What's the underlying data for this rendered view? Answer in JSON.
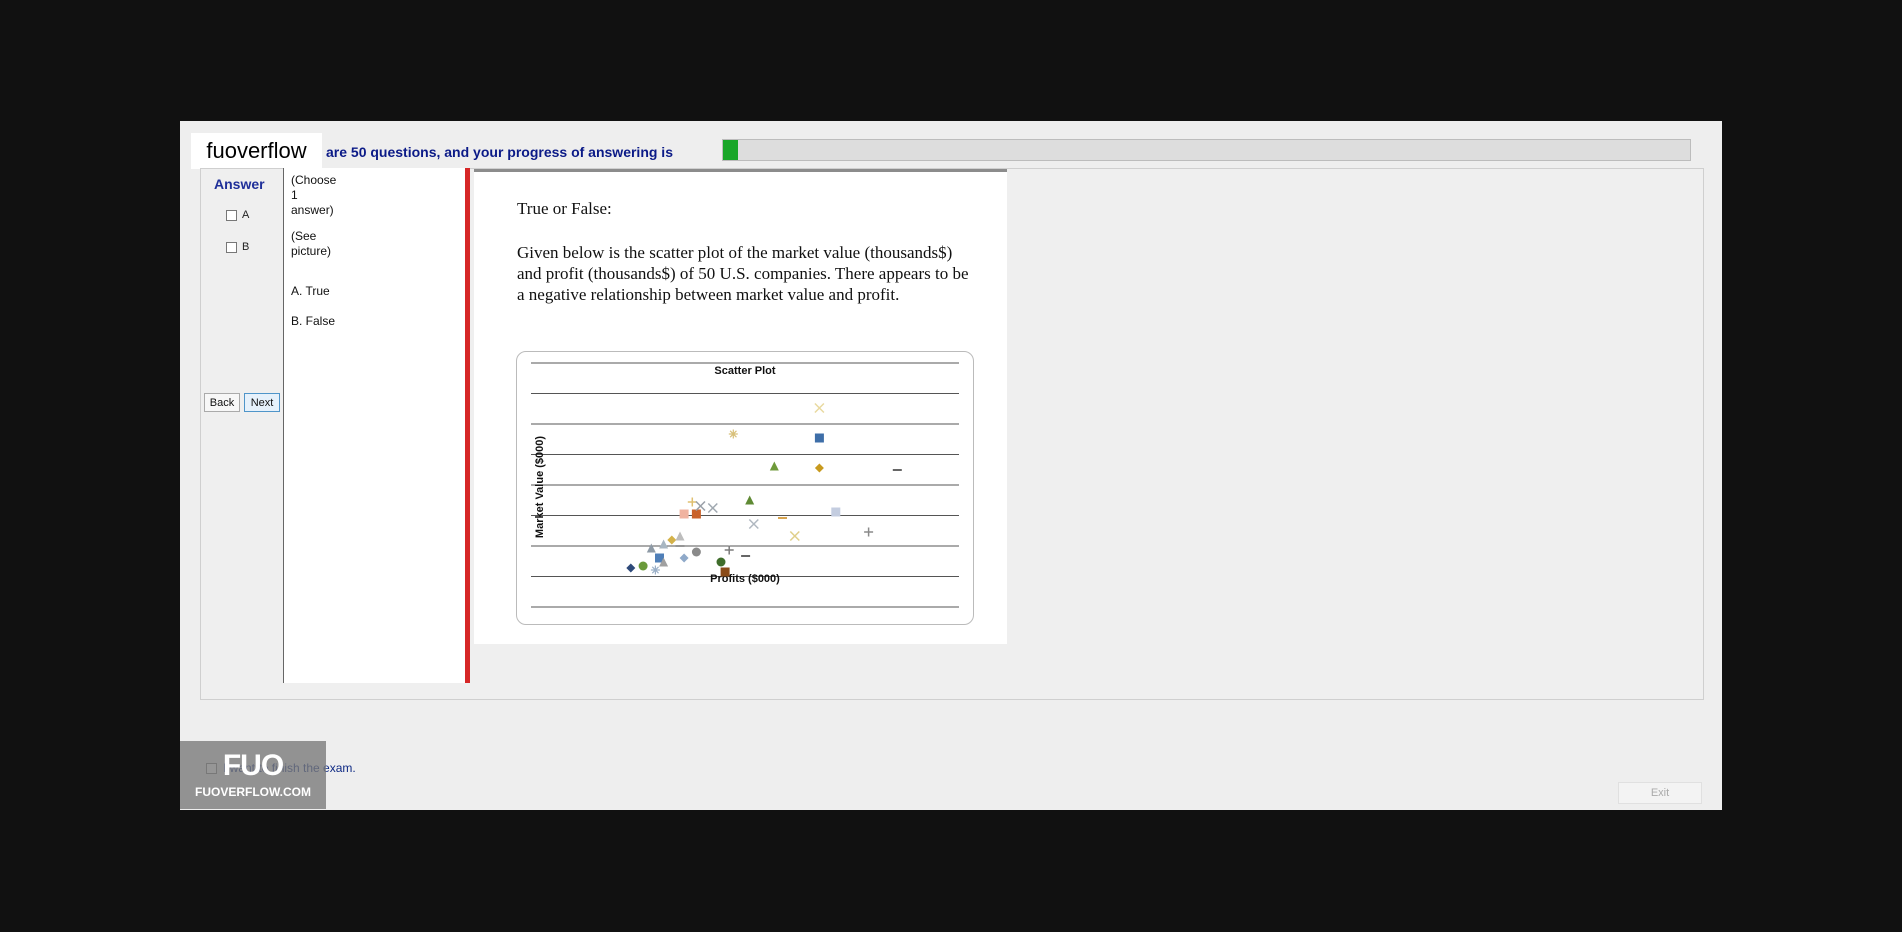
{
  "brand": {
    "name": "fuoverflow"
  },
  "header": {
    "progress_text": "are 50 questions, and your progress of answering is",
    "progress_fraction": 0.016
  },
  "answer_panel": {
    "title": "Answer",
    "options": [
      "A",
      "B"
    ],
    "back_label": "Back",
    "next_label": "Next"
  },
  "choice_list": {
    "choose_line1": "(Choose",
    "choose_line2": "1",
    "choose_line3": "answer)",
    "see_line1": "(See",
    "see_line2": "picture)",
    "a": "A.  True",
    "b": "B.  False"
  },
  "question": {
    "title": "True or False:",
    "body": "Given below is the scatter  plot of the market value (thousands$) and profit (thousands$) of 50 U.S. companies. There appears to be a negative relationship between market value and profit."
  },
  "chart_data": {
    "type": "scatter",
    "title": "Scatter Plot",
    "xlabel": "Profits ($000)",
    "ylabel": "Market Value ($000)",
    "grid": true,
    "legend": "none",
    "points": [
      {
        "x": 0.18,
        "y": 0.12,
        "marker": "diamond",
        "color": "#2e4a7a"
      },
      {
        "x": 0.21,
        "y": 0.13,
        "marker": "circle",
        "color": "#6a9a3a"
      },
      {
        "x": 0.24,
        "y": 0.11,
        "marker": "star",
        "color": "#9bb0c8"
      },
      {
        "x": 0.25,
        "y": 0.17,
        "marker": "square",
        "color": "#4f7fb8"
      },
      {
        "x": 0.26,
        "y": 0.15,
        "marker": "triangle",
        "color": "#a0a0a0"
      },
      {
        "x": 0.23,
        "y": 0.22,
        "marker": "triangle",
        "color": "#8e9aa6"
      },
      {
        "x": 0.26,
        "y": 0.24,
        "marker": "triangle",
        "color": "#a8b6c2"
      },
      {
        "x": 0.28,
        "y": 0.26,
        "marker": "diamond",
        "color": "#d4b24a"
      },
      {
        "x": 0.3,
        "y": 0.28,
        "marker": "triangle",
        "color": "#bdbdbd"
      },
      {
        "x": 0.3,
        "y": 0.23,
        "marker": "dash",
        "color": "#8a8a8a"
      },
      {
        "x": 0.31,
        "y": 0.17,
        "marker": "diamond",
        "color": "#8fa9c9"
      },
      {
        "x": 0.34,
        "y": 0.2,
        "marker": "circle",
        "color": "#8a8a8a"
      },
      {
        "x": 0.4,
        "y": 0.15,
        "marker": "circle",
        "color": "#3f6d2b"
      },
      {
        "x": 0.41,
        "y": 0.1,
        "marker": "square",
        "color": "#8a4b18"
      },
      {
        "x": 0.31,
        "y": 0.39,
        "marker": "square",
        "color": "#f0b3a0"
      },
      {
        "x": 0.34,
        "y": 0.39,
        "marker": "square",
        "color": "#c9622b"
      },
      {
        "x": 0.33,
        "y": 0.45,
        "marker": "plus",
        "color": "#e0c070"
      },
      {
        "x": 0.35,
        "y": 0.43,
        "marker": "x",
        "color": "#9aa0a8"
      },
      {
        "x": 0.38,
        "y": 0.42,
        "marker": "x",
        "color": "#a0a8b0"
      },
      {
        "x": 0.47,
        "y": 0.46,
        "marker": "triangle",
        "color": "#5f8a34"
      },
      {
        "x": 0.43,
        "y": 0.79,
        "marker": "star",
        "color": "#d8c07a"
      },
      {
        "x": 0.42,
        "y": 0.21,
        "marker": "plus",
        "color": "#7b7b7b"
      },
      {
        "x": 0.46,
        "y": 0.18,
        "marker": "dash",
        "color": "#555555"
      },
      {
        "x": 0.48,
        "y": 0.34,
        "marker": "x",
        "color": "#b0b8c0"
      },
      {
        "x": 0.53,
        "y": 0.63,
        "marker": "triangle",
        "color": "#6f9a3a"
      },
      {
        "x": 0.55,
        "y": 0.37,
        "marker": "dash",
        "color": "#d49a3a"
      },
      {
        "x": 0.58,
        "y": 0.28,
        "marker": "x",
        "color": "#e0cf8a"
      },
      {
        "x": 0.64,
        "y": 0.92,
        "marker": "x",
        "color": "#e8d9a0"
      },
      {
        "x": 0.64,
        "y": 0.77,
        "marker": "square",
        "color": "#3e6ea8"
      },
      {
        "x": 0.64,
        "y": 0.62,
        "marker": "diamond",
        "color": "#c89a1e"
      },
      {
        "x": 0.68,
        "y": 0.4,
        "marker": "square",
        "color": "#c4cde0"
      },
      {
        "x": 0.76,
        "y": 0.3,
        "marker": "plus",
        "color": "#8a8a8a"
      },
      {
        "x": 0.83,
        "y": 0.61,
        "marker": "dash",
        "color": "#555555"
      }
    ]
  },
  "footer": {
    "finish_label": "I want to finish the exam.",
    "logo_big": "FUO",
    "logo_small": "FUOVERFLOW.COM",
    "exit_label": "Exit"
  },
  "colors": {
    "progress_text": "#0b1a87",
    "progress_fill": "#19a628",
    "divider": "#d62727"
  }
}
